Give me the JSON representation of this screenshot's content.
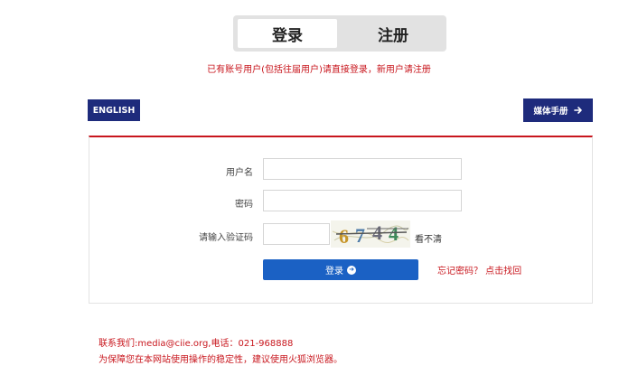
{
  "tabs": {
    "login": "登录",
    "register": "注册"
  },
  "notice": "已有账号用户(包括往届用户)请直接登录，新用户请注册",
  "header": {
    "lang_button": "ENGLISH",
    "media_button": "媒体手册",
    "media_icon": "arrow-right-icon"
  },
  "form": {
    "username_label": "用户名",
    "password_label": "密码",
    "captcha_label": "请输入验证码",
    "captcha_text": "6744",
    "captcha_refresh": "看不清",
    "login_button": "登录",
    "forgot": "忘记密码？ 点击找回"
  },
  "footer": {
    "contact": "联系我们:media@ciie.org,电话：021-968888",
    "browser_tip": "为保障您在本网站使用操作的稳定性，建议使用火狐浏览器。"
  },
  "colors": {
    "accent_red": "#c8161d",
    "navy": "#1e2b7c",
    "button_blue": "#1b61c4"
  }
}
